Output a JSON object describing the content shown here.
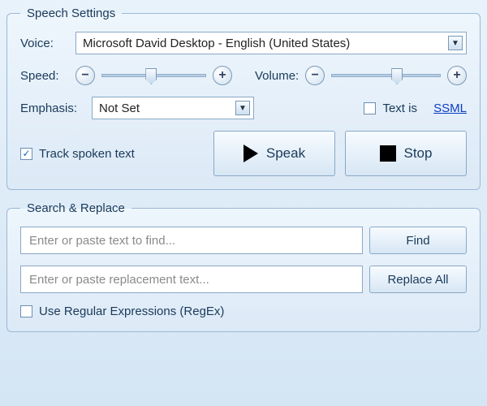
{
  "speech": {
    "legend": "Speech Settings",
    "voice_label": "Voice:",
    "voice_value": "Microsoft David Desktop - English (United States)",
    "speed_label": "Speed:",
    "volume_label": "Volume:",
    "emphasis_label": "Emphasis:",
    "emphasis_value": "Not Set",
    "text_is": "Text is",
    "ssml": "SSML",
    "track_label": "Track spoken text",
    "track_checked": "✓",
    "speak_label": "Speak",
    "stop_label": "Stop",
    "minus": "−",
    "plus": "+"
  },
  "search": {
    "legend": "Search & Replace",
    "find_placeholder": "Enter or paste text to find...",
    "replace_placeholder": "Enter or paste replacement text...",
    "find_label": "Find",
    "replace_all_label": "Replace All",
    "regex_label": "Use Regular Expressions (RegEx)"
  }
}
